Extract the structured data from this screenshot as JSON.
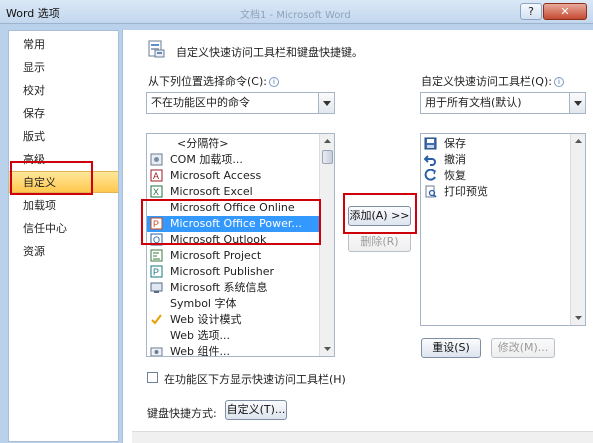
{
  "window": {
    "title": "Word 选项",
    "background_title": "文档1 - Microsoft Word",
    "help_glyph": "?",
    "close_glyph": "✕"
  },
  "sidebar": {
    "items": [
      "常用",
      "显示",
      "校对",
      "保存",
      "版式",
      "高级",
      "自定义",
      "加载项",
      "信任中心",
      "资源"
    ],
    "active_index": 6
  },
  "main": {
    "header_title": "自定义快速访问工具栏和键盘快捷键。",
    "left_label": "从下列位置选择命令(C):",
    "left_combo_value": "不在功能区中的命令",
    "right_label": "自定义快速访问工具栏(Q):",
    "right_combo_value": "用于所有文档(默认)",
    "info_glyph": "i",
    "commands": [
      {
        "label": "<分隔符>",
        "icon": "separator-icon"
      },
      {
        "label": "COM 加载项...",
        "icon": "com-addin-icon"
      },
      {
        "label": "Microsoft Access",
        "icon": "access-icon"
      },
      {
        "label": "Microsoft Excel",
        "icon": "excel-icon"
      },
      {
        "label": "Microsoft Office Online",
        "icon": "office-online-icon"
      },
      {
        "label": "Microsoft Office Power...",
        "icon": "powerpoint-icon"
      },
      {
        "label": "Microsoft Outlook",
        "icon": "outlook-icon"
      },
      {
        "label": "Microsoft Project",
        "icon": "project-icon"
      },
      {
        "label": "Microsoft Publisher",
        "icon": "publisher-icon"
      },
      {
        "label": "Microsoft 系统信息",
        "icon": "system-info-icon"
      },
      {
        "label": "Symbol 字体",
        "icon": "symbol-font-icon"
      },
      {
        "label": "Web 设计模式",
        "icon": "checkmark-icon"
      },
      {
        "label": "Web 选项...",
        "icon": "web-options-icon"
      },
      {
        "label": "Web 组件...",
        "icon": "web-component-icon"
      }
    ],
    "selected_command_index": 5,
    "toolbar_items": [
      {
        "label": "保存",
        "icon": "save-icon"
      },
      {
        "label": "撤消",
        "icon": "undo-icon"
      },
      {
        "label": "恢复",
        "icon": "redo-icon"
      },
      {
        "label": "打印预览",
        "icon": "print-preview-icon"
      }
    ],
    "add_button": "添加(A) >>",
    "remove_button": "删除(R)",
    "reset_button": "重设(S)",
    "modify_button": "修改(M)...",
    "show_below_ribbon_label": "在功能区下方显示快速访问工具栏(H)",
    "shortcut_label": "键盘快捷方式:",
    "customize_button": "自定义(T)..."
  },
  "colors": {
    "highlight_box": "#d0000a",
    "selection": "#3399ff",
    "active_nav": "#ffc84f"
  }
}
